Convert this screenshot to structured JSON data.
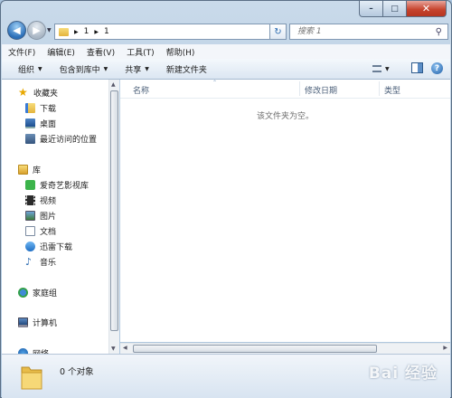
{
  "window": {
    "minimize": "–",
    "maximize": "□",
    "close": "✕"
  },
  "nav": {
    "breadcrumb": [
      "1",
      "1"
    ],
    "search_placeholder": "搜索 1"
  },
  "menubar": [
    "文件(F)",
    "编辑(E)",
    "查看(V)",
    "工具(T)",
    "帮助(H)"
  ],
  "toolbar": {
    "organize": "组织",
    "include_library": "包含到库中",
    "share": "共享",
    "new_folder": "新建文件夹"
  },
  "sidebar": {
    "favorites": {
      "label": "收藏夹",
      "items": [
        "下载",
        "桌面",
        "最近访问的位置"
      ]
    },
    "libraries": {
      "label": "库",
      "items": [
        "爱奇艺影视库",
        "视频",
        "图片",
        "文档",
        "迅雷下载",
        "音乐"
      ]
    },
    "homegroup": "家庭组",
    "computer": "计算机",
    "network": "网络"
  },
  "columns": [
    "名称",
    "修改日期",
    "类型"
  ],
  "empty_message": "该文件夹为空。",
  "status": {
    "count": "0 个对象"
  },
  "watermark": "Bai 经验"
}
